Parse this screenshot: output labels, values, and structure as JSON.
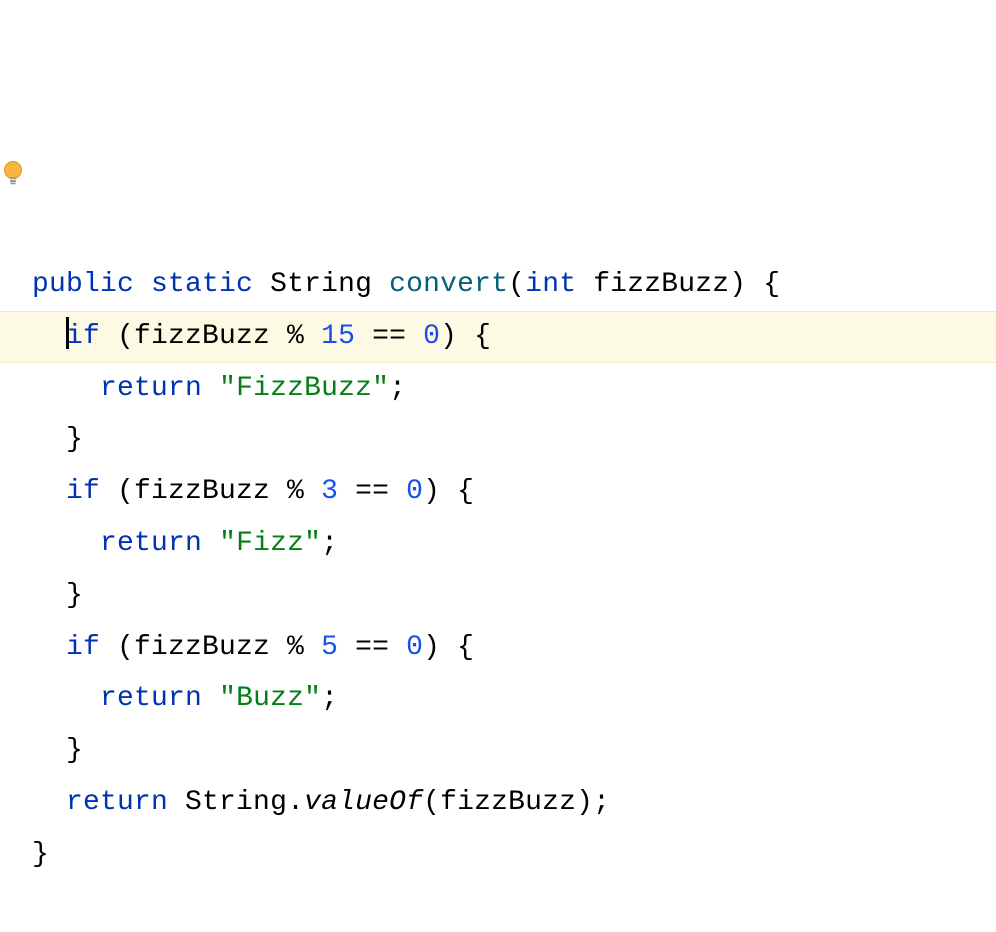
{
  "code": {
    "tokens": {
      "kw_public": "public",
      "kw_static": "static",
      "type_string": "String",
      "method_convert": "convert",
      "paren_open": "(",
      "kw_int": "int",
      "param_name": "fizzBuzz",
      "paren_close_brace": ") {",
      "kw_if": "if",
      "cond1_a": " (fizzBuzz % ",
      "num_15": "15",
      "eq_zero_a": " == ",
      "num_0_a": "0",
      "cond_close": ") {",
      "kw_return": "return",
      "str_fizzbuzz": "\"FizzBuzz\"",
      "semi": ";",
      "brace_close": "}",
      "cond2_a": " (fizzBuzz % ",
      "num_3": "3",
      "eq_zero_b": " == ",
      "num_0_b": "0",
      "str_fizz": "\"Fizz\"",
      "cond3_a": " (fizzBuzz % ",
      "num_5": "5",
      "eq_zero_c": " == ",
      "num_0_c": "0",
      "str_buzz": "\"Buzz\"",
      "ret_final_a": " String.",
      "call_valueOf": "valueOf",
      "ret_final_b": "(fizzBuzz);"
    },
    "icons": {
      "bulb": "intention-bulb-icon"
    }
  }
}
